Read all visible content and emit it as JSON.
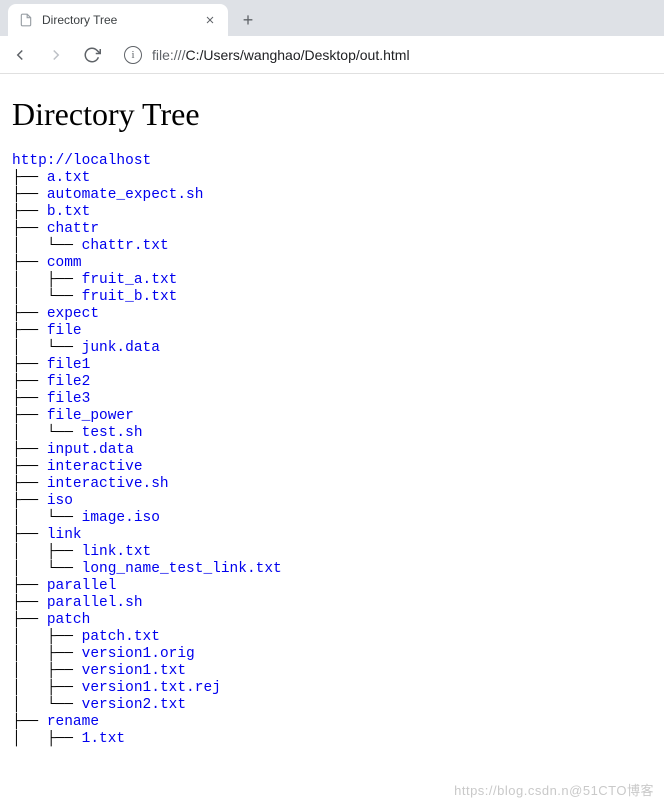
{
  "browser": {
    "tab_title": "Directory Tree",
    "url_proto": "file:///",
    "url_rest": "C:/Users/wanghao/Desktop/out.html"
  },
  "page": {
    "heading": "Directory Tree",
    "root": "http://localhost",
    "items": [
      {
        "p": "├── ",
        "n": "a.txt"
      },
      {
        "p": "├── ",
        "n": "automate_expect.sh"
      },
      {
        "p": "├── ",
        "n": "b.txt"
      },
      {
        "p": "├── ",
        "n": "chattr"
      },
      {
        "p": "│   └── ",
        "n": "chattr.txt"
      },
      {
        "p": "├── ",
        "n": "comm"
      },
      {
        "p": "│   ├── ",
        "n": "fruit_a.txt"
      },
      {
        "p": "│   └── ",
        "n": "fruit_b.txt"
      },
      {
        "p": "├── ",
        "n": "expect"
      },
      {
        "p": "├── ",
        "n": "file"
      },
      {
        "p": "│   └── ",
        "n": "junk.data"
      },
      {
        "p": "├── ",
        "n": "file1"
      },
      {
        "p": "├── ",
        "n": "file2"
      },
      {
        "p": "├── ",
        "n": "file3"
      },
      {
        "p": "├── ",
        "n": "file_power"
      },
      {
        "p": "│   └── ",
        "n": "test.sh"
      },
      {
        "p": "├── ",
        "n": "input.data"
      },
      {
        "p": "├── ",
        "n": "interactive"
      },
      {
        "p": "├── ",
        "n": "interactive.sh"
      },
      {
        "p": "├── ",
        "n": "iso"
      },
      {
        "p": "│   └── ",
        "n": "image.iso"
      },
      {
        "p": "├── ",
        "n": "link"
      },
      {
        "p": "│   ├── ",
        "n": "link.txt"
      },
      {
        "p": "│   └── ",
        "n": "long_name_test_link.txt"
      },
      {
        "p": "├── ",
        "n": "parallel"
      },
      {
        "p": "├── ",
        "n": "parallel.sh"
      },
      {
        "p": "├── ",
        "n": "patch"
      },
      {
        "p": "│   ├── ",
        "n": "patch.txt"
      },
      {
        "p": "│   ├── ",
        "n": "version1.orig"
      },
      {
        "p": "│   ├── ",
        "n": "version1.txt"
      },
      {
        "p": "│   ├── ",
        "n": "version1.txt.rej"
      },
      {
        "p": "│   └── ",
        "n": "version2.txt"
      },
      {
        "p": "├── ",
        "n": "rename"
      },
      {
        "p": "│   ├── ",
        "n": "1.txt"
      }
    ]
  },
  "watermark": "https://blog.csdn.n@51CTO博客"
}
